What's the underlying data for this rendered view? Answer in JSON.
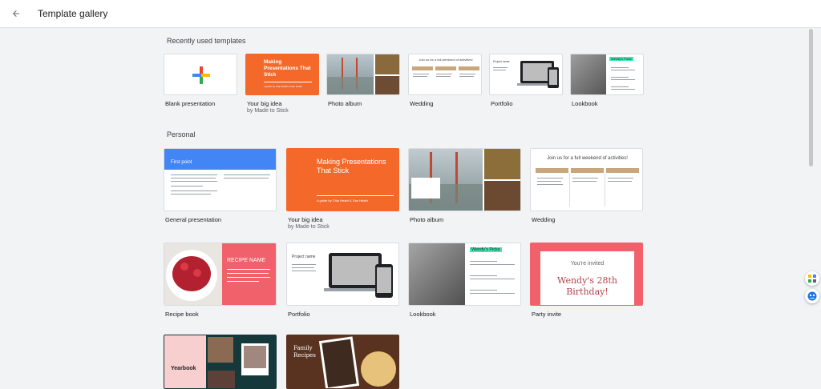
{
  "header": {
    "title": "Template gallery",
    "back_icon": "arrow-back-icon"
  },
  "sections": {
    "recent": "Recently used templates",
    "personal": "Personal"
  },
  "recent": [
    {
      "label": "Blank presentation"
    },
    {
      "label": "Your big idea",
      "sub": "by Made to Stick"
    },
    {
      "label": "Photo album"
    },
    {
      "label": "Wedding"
    },
    {
      "label": "Portfolio"
    },
    {
      "label": "Lookbook"
    }
  ],
  "personal": [
    {
      "label": "General presentation"
    },
    {
      "label": "Your big idea",
      "sub": "by Made to Stick"
    },
    {
      "label": "Photo album"
    },
    {
      "label": "Wedding"
    },
    {
      "label": "Recipe book"
    },
    {
      "label": "Portfolio"
    },
    {
      "label": "Lookbook"
    },
    {
      "label": "Party invite"
    },
    {
      "label": "Yearbook"
    },
    {
      "label": "Family Recipes"
    }
  ],
  "thumb_text": {
    "big_idea_title": "Making Presentations That Stick",
    "big_idea_sub": "A guide by Chip Heath & Dan Heath",
    "first_point": "First point",
    "wedding_head": "Join us for a full weekend of activities!",
    "recipe_name": "RECIPE NAME",
    "project_name": "Project name",
    "lookbook_tag": "Wendy's Picks",
    "invite_small": "You're invited",
    "invite_big": "Wendy's 28th Birthday!",
    "yearbook": "Yearbook",
    "family_recipes": "Family Recipes"
  },
  "colors": {
    "orange": "#f4692a",
    "blue": "#4285f4",
    "coral": "#f0616c",
    "invite_red": "#b5414a",
    "teal": "#3be8b0",
    "dark_green": "#15383a",
    "pink": "#f7cfcf"
  }
}
